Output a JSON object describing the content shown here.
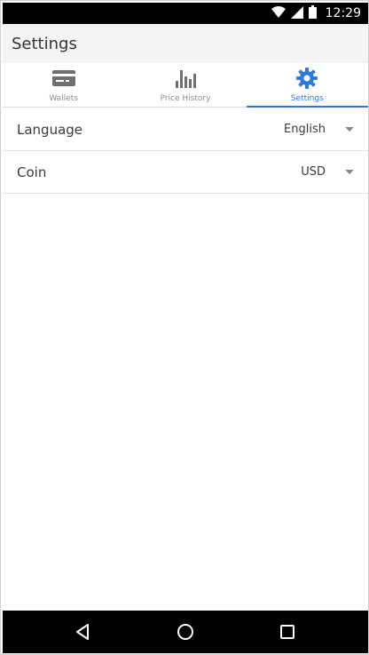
{
  "status_bar": {
    "time": "12:29",
    "icons": [
      "wifi-icon",
      "signal-icon",
      "battery-icon"
    ]
  },
  "app_bar": {
    "title": "Settings"
  },
  "tabs": [
    {
      "label": "Wallets",
      "icon": "wallet-card-icon",
      "active": false
    },
    {
      "label": "Price History",
      "icon": "bar-chart-icon",
      "active": false
    },
    {
      "label": "Settings",
      "icon": "gear-icon",
      "active": true
    }
  ],
  "settings": [
    {
      "label": "Language",
      "value": "English"
    },
    {
      "label": "Coin",
      "value": "USD"
    }
  ],
  "nav_bar": {
    "buttons": [
      "back-icon",
      "home-icon",
      "recents-icon"
    ]
  },
  "colors": {
    "accent": "#2f7ad8",
    "app_bar_bg": "#f4f4f4",
    "status_bar_bg": "#000000",
    "inactive_icon": "#6f6f6f"
  }
}
